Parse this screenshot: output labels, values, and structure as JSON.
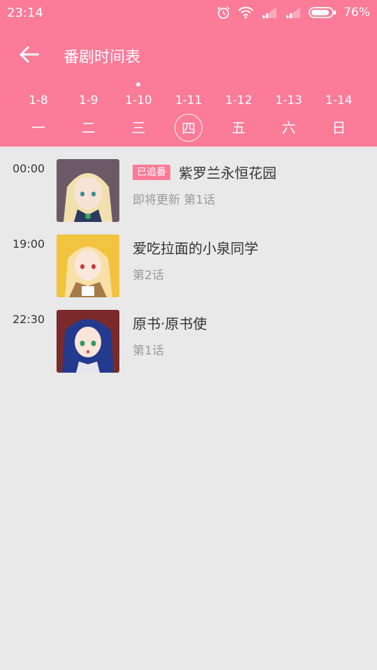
{
  "status_bar": {
    "time": "23:14",
    "battery_percent": "76%",
    "icons": [
      "alarm-icon",
      "wifi-icon",
      "signal-icon",
      "signal-icon",
      "battery-icon"
    ]
  },
  "header": {
    "title": "番剧时间表",
    "back_icon": "back-arrow-icon",
    "color": "#fb7b98"
  },
  "week": {
    "today_index": 2,
    "selected_index": 3,
    "days": [
      {
        "date": "1-8",
        "weekday": "一"
      },
      {
        "date": "1-9",
        "weekday": "二"
      },
      {
        "date": "1-10",
        "weekday": "三"
      },
      {
        "date": "1-11",
        "weekday": "四"
      },
      {
        "date": "1-12",
        "weekday": "五"
      },
      {
        "date": "1-13",
        "weekday": "六"
      },
      {
        "date": "1-14",
        "weekday": "日"
      }
    ]
  },
  "schedule": [
    {
      "time": "00:00",
      "badge": "已追番",
      "title": "紫罗兰永恒花园",
      "subtitle": "即将更新 第1话"
    },
    {
      "time": "19:00",
      "badge": "",
      "title": "爱吃拉面的小泉同学",
      "subtitle": "第2话"
    },
    {
      "time": "22:30",
      "badge": "",
      "title": "原书·原书使",
      "subtitle": "第1话"
    }
  ]
}
